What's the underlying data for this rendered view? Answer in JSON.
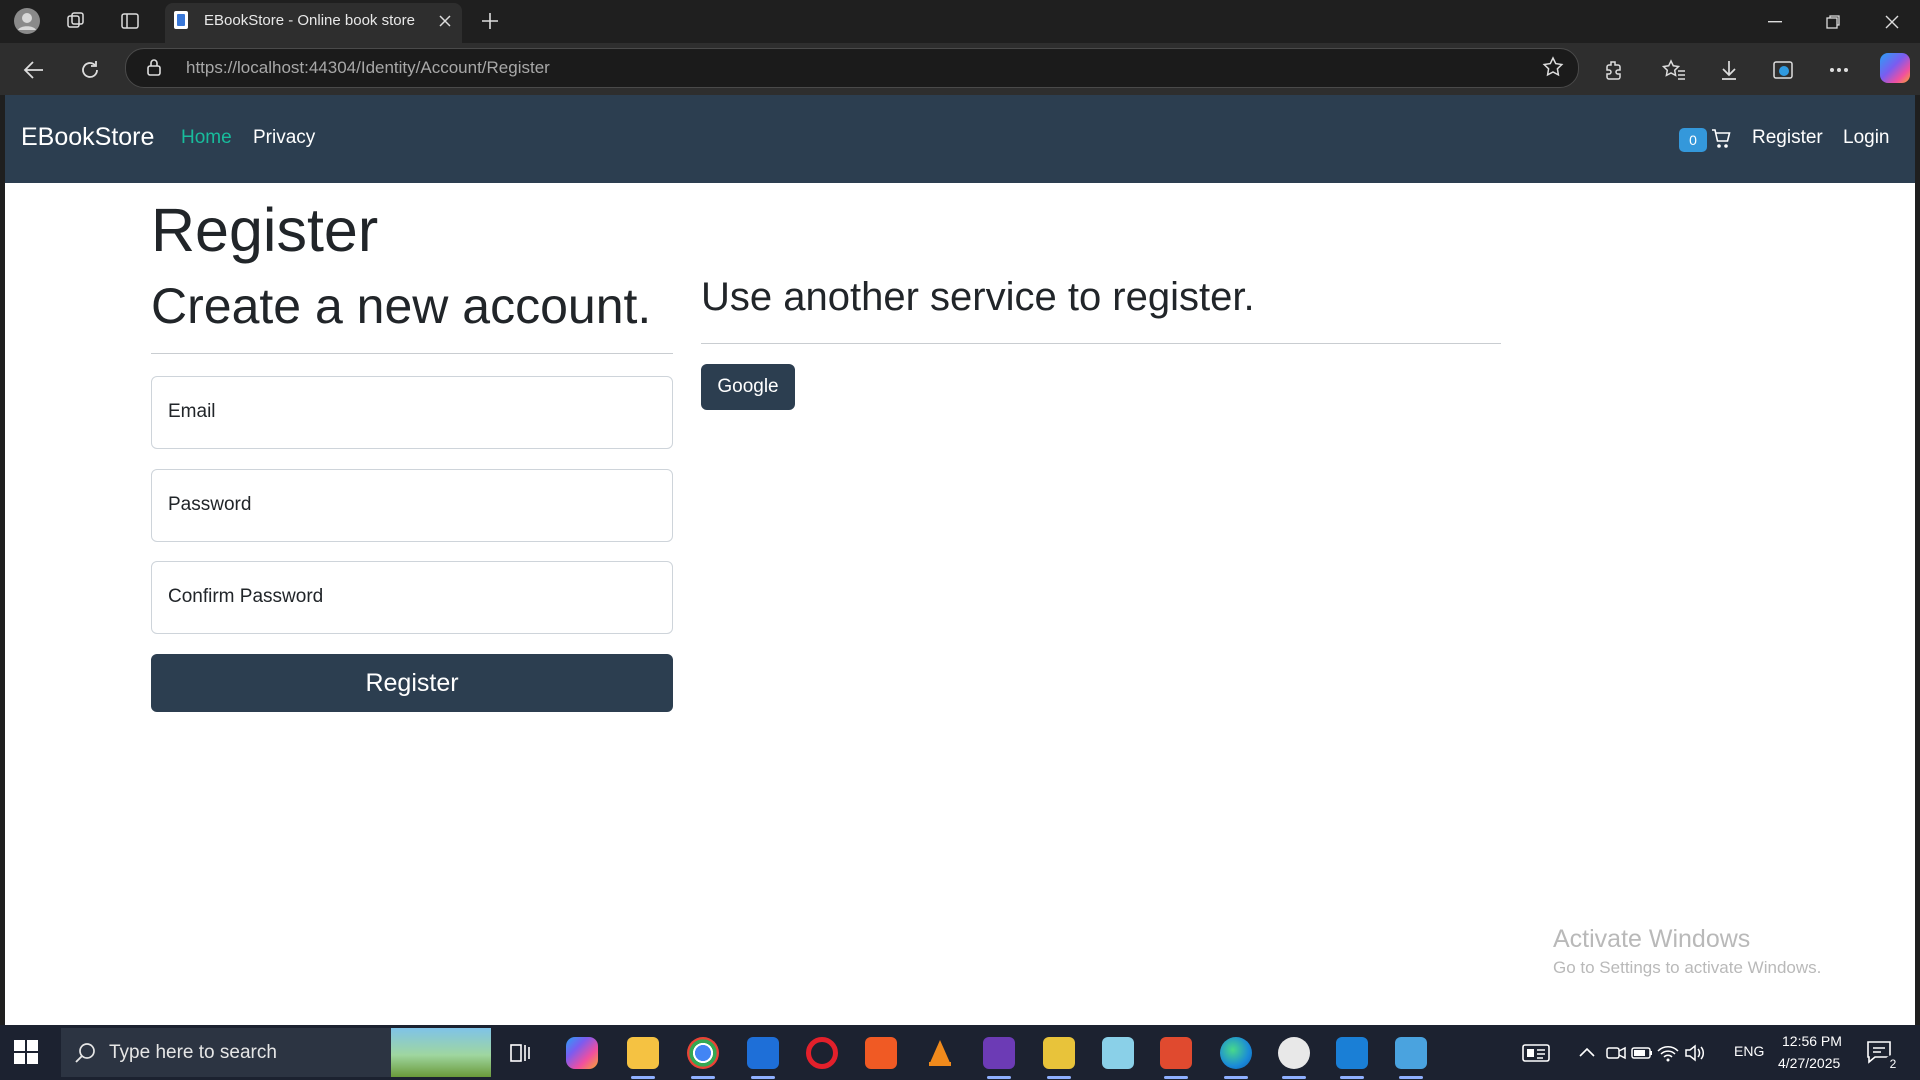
{
  "browser": {
    "tab_title": "EBookStore - Online book store",
    "address": "https://localhost:44304/Identity/Account/Register"
  },
  "site": {
    "brand": "EBookStore",
    "nav": [
      {
        "label": "Home",
        "active": true
      },
      {
        "label": "Privacy",
        "active": false
      }
    ],
    "cart_count": "0",
    "right_nav": [
      "Register",
      "Login"
    ]
  },
  "page": {
    "title": "Register",
    "subtitle": "Create a new account.",
    "external_heading": "Use another service to register.",
    "fields": [
      {
        "label": "Email"
      },
      {
        "label": "Password"
      },
      {
        "label": "Confirm Password"
      }
    ],
    "submit_label": "Register",
    "external_providers": [
      "Google"
    ]
  },
  "watermark": {
    "title": "Activate Windows",
    "subtitle": "Go to Settings to activate Windows."
  },
  "taskbar": {
    "search_placeholder": "Type here to search",
    "language": "ENG",
    "time": "12:56 PM",
    "date": "4/27/2025",
    "notification_count": "2"
  },
  "colors": {
    "navbar": "#2c3e50",
    "nav_active": "#18bc9c",
    "badge": "#3498db",
    "primary_button": "#2c3e50"
  }
}
